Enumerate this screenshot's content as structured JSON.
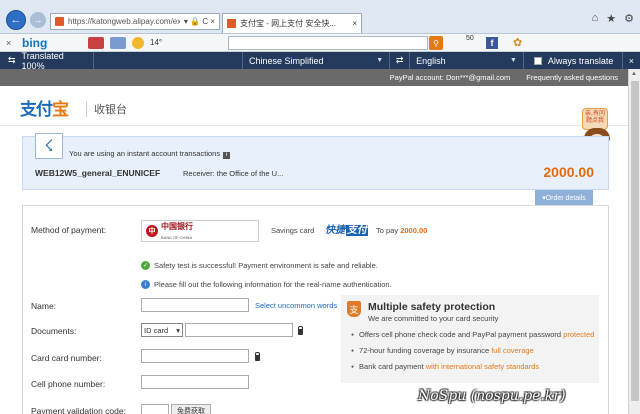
{
  "browser": {
    "url": "https://katongweb.alipay.com/exp",
    "tab_title": "支付宝 - 网上支付 安全快...",
    "addr_tools": "▾ 🔒 C ×",
    "controls": {
      "home": "⌂",
      "star": "★",
      "gear": "⚙"
    }
  },
  "bing_bar": {
    "close": "×",
    "logo": "bing",
    "temperature": "14°",
    "badge_count": "50",
    "facebook": "f"
  },
  "translator": {
    "status": "Translated 100%",
    "from_language": "Chinese Simplified",
    "to_language": "English",
    "always_translate": "Always translate"
  },
  "site": {
    "account": "PayPal account: Don***@gmail.com",
    "faq": "Frequently asked questions",
    "logo_main": "支付",
    "logo_accent": "宝",
    "cashier": "收银台",
    "mascot_bubble": "亲,有问题点我"
  },
  "order": {
    "instant_msg": "You are using an instant account transactions",
    "info_icon": "i",
    "order_id": "WEB12W5_general_ENUNICEF",
    "receiver": "Receiver: the Office of the U...",
    "amount": "2000.00",
    "details_toggle": "▾Order details"
  },
  "payment": {
    "method_label": "Method of payment:",
    "bank_name": "中国银行",
    "bank_sub": "BANK OF CHINA",
    "card_type": "Savings card",
    "quick_pay_a": "快捷",
    "quick_pay_b": "支付",
    "to_pay_label": "To pay",
    "to_pay_amount": "2000.00",
    "safety_ok": "Safety test is successful! Payment environment is safe and reliable.",
    "fill_info": "Please fill out the following information for the real-name authentication.",
    "name_label": "Name:",
    "uncommon_words": "Select uncommon words",
    "documents_label": "Documents:",
    "id_card": "ID card",
    "card_number_label": "Card card number:",
    "phone_label": "Cell phone number:",
    "validation_label": "Payment validation code:",
    "get_code": "免费获取"
  },
  "safety": {
    "icon": "支",
    "title": "Multiple safety protection",
    "subtitle": "We are committed to your card security",
    "items": [
      {
        "text": "Offers cell phone check code and PayPal payment password ",
        "hl": "protected"
      },
      {
        "text": "72-hour funding coverage by insurance ",
        "hl": "full coverage"
      },
      {
        "text": "Bank card payment ",
        "hl": "with international safety standards"
      }
    ]
  },
  "watermark": "NoSpu (nospu.pe.kr)",
  "colors": {
    "accent": "#e36b0e",
    "brand_blue": "#1a6bb8",
    "translator_bar": "#233a5c"
  }
}
